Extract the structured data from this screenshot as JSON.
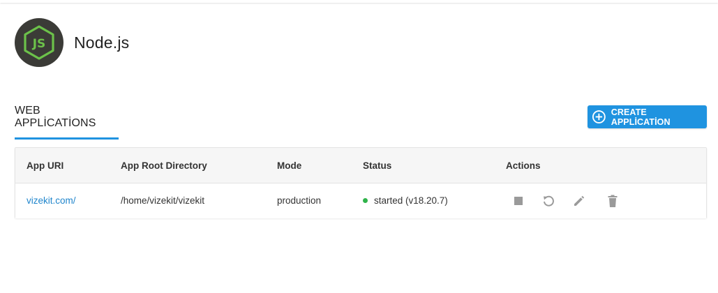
{
  "app": {
    "name": "Node.js",
    "logo_icon": "nodejs-hexagon-logo"
  },
  "section": {
    "title": "WEB APPLİCATİONS"
  },
  "actions": {
    "create_label": "CREATE APPLİCATİON",
    "create_icon": "plus-circle-icon"
  },
  "table": {
    "headers": {
      "uri": "App URI",
      "root": "App Root Directory",
      "mode": "Mode",
      "status": "Status",
      "actions": "Actions"
    },
    "rows": [
      {
        "uri": "vizekit.com/",
        "root": "/home/vizekit/vizekit",
        "mode": "production",
        "status": "started (v18.20.7)",
        "status_color": "#2fb34a",
        "action_icons": [
          "stop-icon",
          "restart-icon",
          "edit-icon",
          "trash-icon"
        ]
      }
    ]
  },
  "colors": {
    "accent": "#1f93e0",
    "link": "#1f85cc",
    "logo_bg": "#3b3b37",
    "logo_green": "#6cc24a",
    "icon_gray": "#9a9a9a"
  }
}
